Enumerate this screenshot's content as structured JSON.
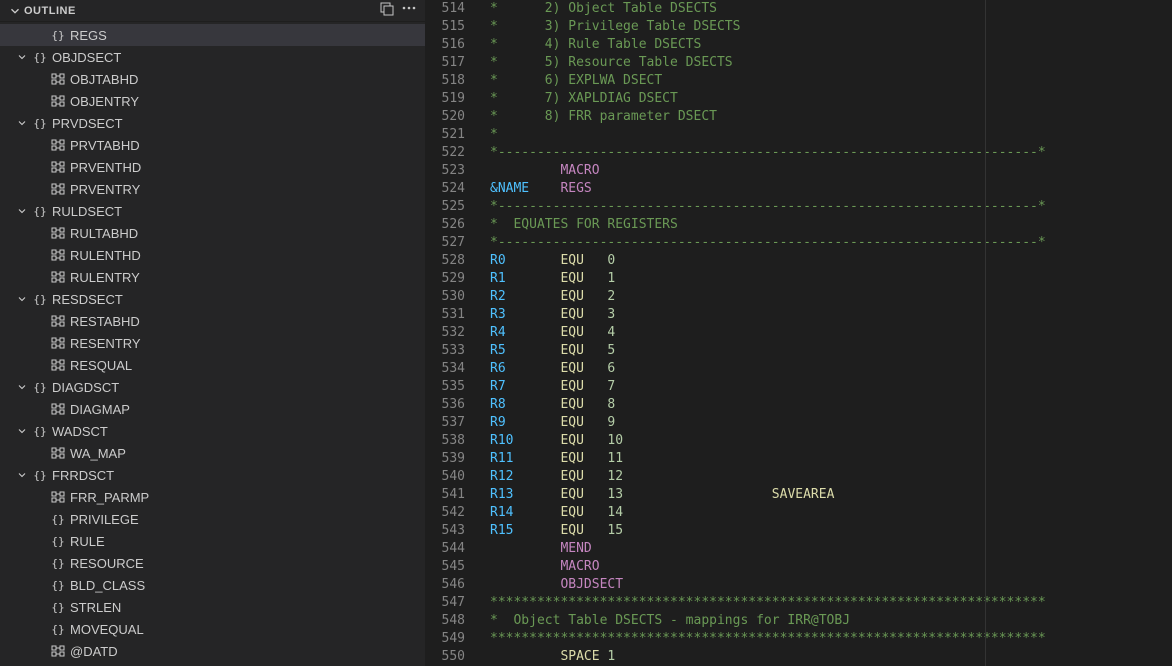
{
  "outline": {
    "title": "OUTLINE",
    "items": [
      {
        "depth": 1,
        "twisty": "none",
        "kind": "ns",
        "label": "REGS",
        "selected": true
      },
      {
        "depth": 0,
        "twisty": "open",
        "kind": "ns",
        "label": "OBJDSECT"
      },
      {
        "depth": 1,
        "twisty": "none",
        "kind": "struct",
        "label": "OBJTABHD"
      },
      {
        "depth": 1,
        "twisty": "none",
        "kind": "struct",
        "label": "OBJENTRY"
      },
      {
        "depth": 0,
        "twisty": "open",
        "kind": "ns",
        "label": "PRVDSECT"
      },
      {
        "depth": 1,
        "twisty": "none",
        "kind": "struct",
        "label": "PRVTABHD"
      },
      {
        "depth": 1,
        "twisty": "none",
        "kind": "struct",
        "label": "PRVENTHD"
      },
      {
        "depth": 1,
        "twisty": "none",
        "kind": "struct",
        "label": "PRVENTRY"
      },
      {
        "depth": 0,
        "twisty": "open",
        "kind": "ns",
        "label": "RULDSECT"
      },
      {
        "depth": 1,
        "twisty": "none",
        "kind": "struct",
        "label": "RULTABHD"
      },
      {
        "depth": 1,
        "twisty": "none",
        "kind": "struct",
        "label": "RULENTHD",
        "cursor": true
      },
      {
        "depth": 1,
        "twisty": "none",
        "kind": "struct",
        "label": "RULENTRY"
      },
      {
        "depth": 0,
        "twisty": "open",
        "kind": "ns",
        "label": "RESDSECT"
      },
      {
        "depth": 1,
        "twisty": "none",
        "kind": "struct",
        "label": "RESTABHD"
      },
      {
        "depth": 1,
        "twisty": "none",
        "kind": "struct",
        "label": "RESENTRY"
      },
      {
        "depth": 1,
        "twisty": "none",
        "kind": "struct",
        "label": "RESQUAL"
      },
      {
        "depth": 0,
        "twisty": "open",
        "kind": "ns",
        "label": "DIAGDSCT"
      },
      {
        "depth": 1,
        "twisty": "none",
        "kind": "struct",
        "label": "DIAGMAP"
      },
      {
        "depth": 0,
        "twisty": "open",
        "kind": "ns",
        "label": "WADSCT"
      },
      {
        "depth": 1,
        "twisty": "none",
        "kind": "struct",
        "label": "WA_MAP"
      },
      {
        "depth": 0,
        "twisty": "open",
        "kind": "ns",
        "label": "FRRDSCT"
      },
      {
        "depth": 1,
        "twisty": "none",
        "kind": "struct",
        "label": "FRR_PARMP"
      },
      {
        "depth": 1,
        "twisty": "none",
        "kind": "ns",
        "label": "PRIVILEGE"
      },
      {
        "depth": 1,
        "twisty": "none",
        "kind": "ns",
        "label": "RULE"
      },
      {
        "depth": 1,
        "twisty": "none",
        "kind": "ns",
        "label": "RESOURCE"
      },
      {
        "depth": 1,
        "twisty": "none",
        "kind": "ns",
        "label": "BLD_CLASS"
      },
      {
        "depth": 1,
        "twisty": "none",
        "kind": "ns",
        "label": "STRLEN"
      },
      {
        "depth": 1,
        "twisty": "none",
        "kind": "ns",
        "label": "MOVEQUAL"
      },
      {
        "depth": 1,
        "twisty": "none",
        "kind": "struct",
        "label": "@DATD"
      }
    ]
  },
  "editor": {
    "startLine": 514,
    "lines": [
      {
        "segments": [
          {
            "cls": "tok-comment",
            "text": "*      2) Object Table DSECTS"
          }
        ]
      },
      {
        "segments": [
          {
            "cls": "tok-comment",
            "text": "*      3) Privilege Table DSECTS"
          }
        ]
      },
      {
        "segments": [
          {
            "cls": "tok-comment",
            "text": "*      4) Rule Table DSECTS"
          }
        ]
      },
      {
        "segments": [
          {
            "cls": "tok-comment",
            "text": "*      5) Resource Table DSECTS"
          }
        ]
      },
      {
        "segments": [
          {
            "cls": "tok-comment",
            "text": "*      6) EXPLWA DSECT"
          }
        ]
      },
      {
        "segments": [
          {
            "cls": "tok-comment",
            "text": "*      7) XAPLDIAG DSECT"
          }
        ]
      },
      {
        "segments": [
          {
            "cls": "tok-comment",
            "text": "*      8) FRR parameter DSECT"
          }
        ]
      },
      {
        "segments": [
          {
            "cls": "tok-comment",
            "text": "*"
          }
        ]
      },
      {
        "segments": [
          {
            "cls": "tok-comment",
            "text": "*---------------------------------------------------------------------*"
          }
        ]
      },
      {
        "segments": [
          {
            "cls": "",
            "text": "         "
          },
          {
            "cls": "tok-macro",
            "text": "MACRO"
          }
        ]
      },
      {
        "segments": [
          {
            "cls": "tok-name",
            "text": "&NAME"
          },
          {
            "cls": "",
            "text": "    "
          },
          {
            "cls": "tok-macro",
            "text": "REGS"
          }
        ]
      },
      {
        "segments": [
          {
            "cls": "tok-comment",
            "text": "*---------------------------------------------------------------------*"
          }
        ]
      },
      {
        "segments": [
          {
            "cls": "tok-comment",
            "text": "*  EQUATES FOR REGISTERS"
          }
        ]
      },
      {
        "segments": [
          {
            "cls": "tok-comment",
            "text": "*---------------------------------------------------------------------*"
          }
        ]
      },
      {
        "segments": [
          {
            "cls": "tok-label",
            "text": "R0"
          },
          {
            "cls": "",
            "text": "       "
          },
          {
            "cls": "tok-op",
            "text": "EQU"
          },
          {
            "cls": "",
            "text": "   "
          },
          {
            "cls": "tok-num",
            "text": "0"
          }
        ]
      },
      {
        "segments": [
          {
            "cls": "tok-label",
            "text": "R1"
          },
          {
            "cls": "",
            "text": "       "
          },
          {
            "cls": "tok-op",
            "text": "EQU"
          },
          {
            "cls": "",
            "text": "   "
          },
          {
            "cls": "tok-num",
            "text": "1"
          }
        ]
      },
      {
        "segments": [
          {
            "cls": "tok-label",
            "text": "R2"
          },
          {
            "cls": "",
            "text": "       "
          },
          {
            "cls": "tok-op",
            "text": "EQU"
          },
          {
            "cls": "",
            "text": "   "
          },
          {
            "cls": "tok-num",
            "text": "2"
          }
        ]
      },
      {
        "segments": [
          {
            "cls": "tok-label",
            "text": "R3"
          },
          {
            "cls": "",
            "text": "       "
          },
          {
            "cls": "tok-op",
            "text": "EQU"
          },
          {
            "cls": "",
            "text": "   "
          },
          {
            "cls": "tok-num",
            "text": "3"
          }
        ]
      },
      {
        "segments": [
          {
            "cls": "tok-label",
            "text": "R4"
          },
          {
            "cls": "",
            "text": "       "
          },
          {
            "cls": "tok-op",
            "text": "EQU"
          },
          {
            "cls": "",
            "text": "   "
          },
          {
            "cls": "tok-num",
            "text": "4"
          }
        ]
      },
      {
        "segments": [
          {
            "cls": "tok-label",
            "text": "R5"
          },
          {
            "cls": "",
            "text": "       "
          },
          {
            "cls": "tok-op",
            "text": "EQU"
          },
          {
            "cls": "",
            "text": "   "
          },
          {
            "cls": "tok-num",
            "text": "5"
          }
        ]
      },
      {
        "segments": [
          {
            "cls": "tok-label",
            "text": "R6"
          },
          {
            "cls": "",
            "text": "       "
          },
          {
            "cls": "tok-op",
            "text": "EQU"
          },
          {
            "cls": "",
            "text": "   "
          },
          {
            "cls": "tok-num",
            "text": "6"
          }
        ]
      },
      {
        "segments": [
          {
            "cls": "tok-label",
            "text": "R7"
          },
          {
            "cls": "",
            "text": "       "
          },
          {
            "cls": "tok-op",
            "text": "EQU"
          },
          {
            "cls": "",
            "text": "   "
          },
          {
            "cls": "tok-num",
            "text": "7"
          }
        ]
      },
      {
        "segments": [
          {
            "cls": "tok-label",
            "text": "R8"
          },
          {
            "cls": "",
            "text": "       "
          },
          {
            "cls": "tok-op",
            "text": "EQU"
          },
          {
            "cls": "",
            "text": "   "
          },
          {
            "cls": "tok-num",
            "text": "8"
          }
        ]
      },
      {
        "segments": [
          {
            "cls": "tok-label",
            "text": "R9"
          },
          {
            "cls": "",
            "text": "       "
          },
          {
            "cls": "tok-op",
            "text": "EQU"
          },
          {
            "cls": "",
            "text": "   "
          },
          {
            "cls": "tok-num",
            "text": "9"
          }
        ]
      },
      {
        "segments": [
          {
            "cls": "tok-label",
            "text": "R10"
          },
          {
            "cls": "",
            "text": "      "
          },
          {
            "cls": "tok-op",
            "text": "EQU"
          },
          {
            "cls": "",
            "text": "   "
          },
          {
            "cls": "tok-num",
            "text": "10"
          }
        ]
      },
      {
        "segments": [
          {
            "cls": "tok-label",
            "text": "R11"
          },
          {
            "cls": "",
            "text": "      "
          },
          {
            "cls": "tok-op",
            "text": "EQU"
          },
          {
            "cls": "",
            "text": "   "
          },
          {
            "cls": "tok-num",
            "text": "11"
          }
        ]
      },
      {
        "segments": [
          {
            "cls": "tok-label",
            "text": "R12"
          },
          {
            "cls": "",
            "text": "      "
          },
          {
            "cls": "tok-op",
            "text": "EQU"
          },
          {
            "cls": "",
            "text": "   "
          },
          {
            "cls": "tok-num",
            "text": "12"
          }
        ]
      },
      {
        "segments": [
          {
            "cls": "tok-label",
            "text": "R13"
          },
          {
            "cls": "",
            "text": "      "
          },
          {
            "cls": "tok-op",
            "text": "EQU"
          },
          {
            "cls": "",
            "text": "   "
          },
          {
            "cls": "tok-num",
            "text": "13"
          },
          {
            "cls": "",
            "text": "                   "
          },
          {
            "cls": "tok-id",
            "text": "SAVEAREA"
          }
        ]
      },
      {
        "segments": [
          {
            "cls": "tok-label",
            "text": "R14"
          },
          {
            "cls": "",
            "text": "      "
          },
          {
            "cls": "tok-op",
            "text": "EQU"
          },
          {
            "cls": "",
            "text": "   "
          },
          {
            "cls": "tok-num",
            "text": "14"
          }
        ]
      },
      {
        "segments": [
          {
            "cls": "tok-label",
            "text": "R15"
          },
          {
            "cls": "",
            "text": "      "
          },
          {
            "cls": "tok-op",
            "text": "EQU"
          },
          {
            "cls": "",
            "text": "   "
          },
          {
            "cls": "tok-num",
            "text": "15"
          }
        ]
      },
      {
        "segments": [
          {
            "cls": "",
            "text": "         "
          },
          {
            "cls": "tok-macro",
            "text": "MEND"
          }
        ]
      },
      {
        "segments": [
          {
            "cls": "",
            "text": "         "
          },
          {
            "cls": "tok-macro",
            "text": "MACRO"
          }
        ]
      },
      {
        "segments": [
          {
            "cls": "",
            "text": "         "
          },
          {
            "cls": "tok-macro",
            "text": "OBJDSECT"
          }
        ]
      },
      {
        "segments": [
          {
            "cls": "tok-comment",
            "text": "***********************************************************************"
          }
        ]
      },
      {
        "segments": [
          {
            "cls": "tok-comment",
            "text": "*  Object Table DSECTS - mappings for IRR@TOBJ"
          }
        ]
      },
      {
        "segments": [
          {
            "cls": "tok-comment",
            "text": "***********************************************************************"
          }
        ]
      },
      {
        "segments": [
          {
            "cls": "",
            "text": "         "
          },
          {
            "cls": "tok-op",
            "text": "SPACE"
          },
          {
            "cls": "",
            "text": " "
          },
          {
            "cls": "tok-num",
            "text": "1"
          }
        ]
      }
    ]
  }
}
